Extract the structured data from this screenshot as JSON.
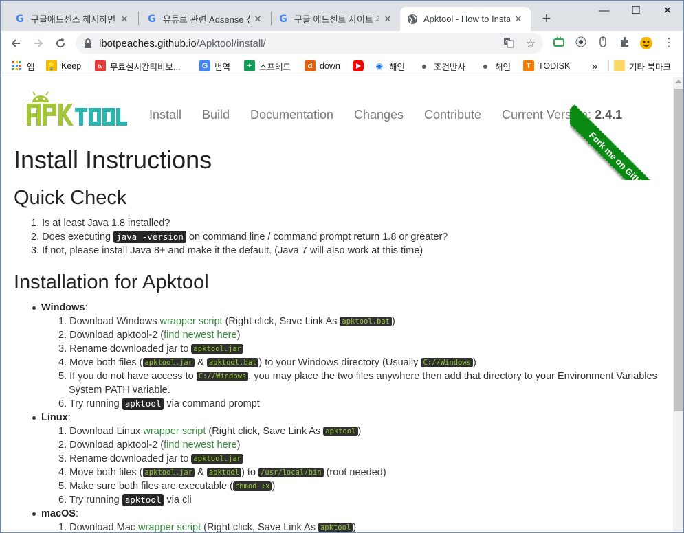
{
  "browser": {
    "tabs": [
      {
        "title": "구글애드센스 해지하면"
      },
      {
        "title": "유튜브 관련 Adsense 신"
      },
      {
        "title": "구글 에드센트 사이트 추"
      },
      {
        "title": "Apktool - How to Insta"
      }
    ],
    "new_tab_label": "+",
    "window_controls": {
      "minimize": "—",
      "maximize": "☐",
      "close": "✕"
    },
    "url_host": "ibotpeaches.github.io",
    "url_path": "/Apktool/install/",
    "bookmarks": [
      {
        "label": "앱"
      },
      {
        "label": "Keep"
      },
      {
        "label": "무료실시간티비보..."
      },
      {
        "label": "번역"
      },
      {
        "label": "스프레드"
      },
      {
        "label": "down"
      },
      {
        "label": ""
      },
      {
        "label": "해인"
      },
      {
        "label": "조건반사"
      },
      {
        "label": "해인"
      },
      {
        "label": "TODISK"
      },
      {
        "label": "기타 북마크"
      }
    ],
    "bookmarks_overflow": "»"
  },
  "site": {
    "logo_text": "APKTOOL",
    "nav": [
      "Install",
      "Build",
      "Documentation",
      "Changes",
      "Contribute"
    ],
    "version_label": "Current Version: ",
    "version_value": "2.4.1",
    "ribbon": "Fork me on GitHub"
  },
  "content": {
    "title": "Install Instructions",
    "quick_check": {
      "heading": "Quick Check",
      "items": [
        {
          "pre": "Is at least Java 1.8 installed?"
        },
        {
          "pre": "Does executing ",
          "code": "java -version",
          "post": " on command line / command prompt return 1.8 or greater?"
        },
        {
          "pre": "If not, please install Java 8+ and make it the default. (Java 7 will also work at this time)"
        }
      ]
    },
    "install": {
      "heading": "Installation for Apktool",
      "windows": {
        "label": "Windows",
        "steps": {
          "s1_pre": "Download Windows ",
          "s1_link": "wrapper script",
          "s1_mid": " (Right click, Save Link As ",
          "s1_code": "apktool.bat",
          "s1_post": ")",
          "s2_pre": "Download apktool-2 (",
          "s2_link": "find newest here",
          "s2_post": ")",
          "s3_pre": "Rename downloaded jar to ",
          "s3_code": "apktool.jar",
          "s4_pre": "Move both files (",
          "s4_code1": "apktool.jar",
          "s4_amp": " & ",
          "s4_code2": "apktool.bat",
          "s4_mid": ") to your Windows directory (Usually ",
          "s4_code3": "C://Windows",
          "s4_post": ")",
          "s5_pre": "If you do not have access to ",
          "s5_code": "C://Windows",
          "s5_post": ", you may place the two files anywhere then add that directory to your Environment Variables",
          "s5_cont": "System PATH variable.",
          "s6_pre": "Try running ",
          "s6_code": "apktool",
          "s6_post": " via command prompt"
        }
      },
      "linux": {
        "label": "Linux",
        "steps": {
          "s1_pre": "Download Linux ",
          "s1_link": "wrapper script",
          "s1_mid": " (Right click, Save Link As ",
          "s1_code": "apktool",
          "s1_post": ")",
          "s2_pre": "Download apktool-2 (",
          "s2_link": "find newest here",
          "s2_post": ")",
          "s3_pre": "Rename downloaded jar to ",
          "s3_code": "apktool.jar",
          "s4_pre": "Move both files (",
          "s4_code1": "apktool.jar",
          "s4_amp": " & ",
          "s4_code2": "apktool",
          "s4_mid": ") to ",
          "s4_code3": "/usr/local/bin",
          "s4_post": " (root needed)",
          "s5_pre": "Make sure both files are executable (",
          "s5_code": "chmod +x",
          "s5_post": ")",
          "s6_pre": "Try running ",
          "s6_code": "apktool",
          "s6_post": " via cli"
        }
      },
      "macos": {
        "label": "macOS",
        "steps": {
          "s1_pre": "Download Mac ",
          "s1_link": "wrapper script",
          "s1_mid": " (Right click, Save Link As ",
          "s1_code": "apktool",
          "s1_post": ")"
        }
      }
    }
  },
  "colors": {
    "link": "#358a3e",
    "ribbon": "#0a8a12",
    "logo_green": "#a4c639",
    "logo_teal": "#29b6b0"
  }
}
